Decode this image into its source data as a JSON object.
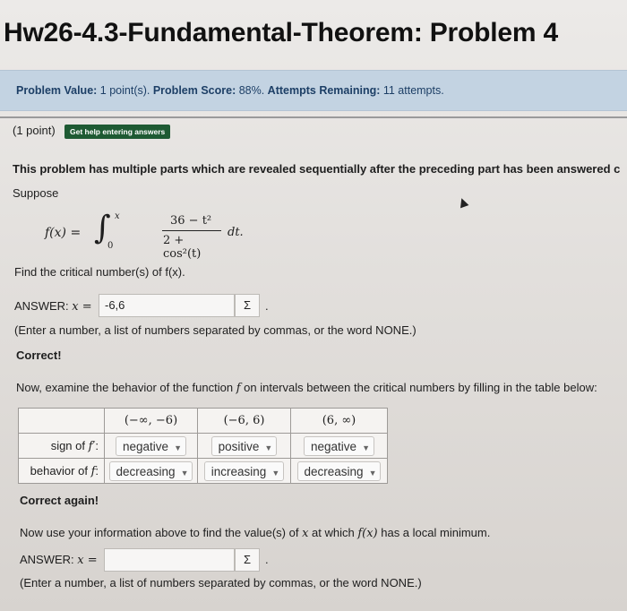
{
  "header": {
    "title": "Hw26-4.3-Fundamental-Theorem: Problem 4"
  },
  "info": {
    "value_label": "Problem Value:",
    "value_text": " 1 point(s). ",
    "score_label": "Problem Score:",
    "score_text": " 88%. ",
    "attempts_label": "Attempts Remaining:",
    "attempts_text": " 11 attempts."
  },
  "problem": {
    "points": "(1 point)",
    "help_button": "Get help entering answers",
    "intro": "This problem has multiple parts which are revealed sequentially after the preceding part has been answered c",
    "suppose": "Suppose",
    "formula": {
      "lhs": "f(x) =",
      "upper": "x",
      "lower": "0",
      "numerator": "36 − t²",
      "denominator": "2 + cos²(t)",
      "dt": "dt."
    },
    "part1": {
      "question": "Find the critical number(s) of f(x).",
      "answer_label": "ANSWER:",
      "answer_var": "x =",
      "answer_value": "-6,6",
      "sigma": "Σ",
      "period": ".",
      "hint": "(Enter a number, a list of numbers separated by commas, or the word NONE.)",
      "status": "Correct!"
    },
    "part2": {
      "prompt_a": "Now, examine the behavior of the function ",
      "prompt_f": "f",
      "prompt_b": " on intervals between the critical numbers by filling in the table below:",
      "headers": [
        "(−∞, −6)",
        "(−6, 6)",
        "(6, ∞)"
      ],
      "sign_label_a": "sign of ",
      "sign_label_f": "f′",
      "sign_label_b": ":",
      "sign_values": [
        "negative",
        "positive",
        "negative"
      ],
      "behavior_label_a": "behavior of ",
      "behavior_label_f": "f",
      "behavior_label_b": ":",
      "behavior_values": [
        "decreasing",
        "increasing",
        "decreasing"
      ],
      "status": "Correct again!"
    },
    "part3": {
      "prompt_a": "Now use your information above to find the value(s) of ",
      "prompt_x": "x",
      "prompt_b": " at which ",
      "prompt_fx": "f(x)",
      "prompt_c": " has a local minimum.",
      "answer_label": "ANSWER:",
      "answer_var": "x =",
      "answer_value": "",
      "sigma": "Σ",
      "period": ".",
      "hint": "(Enter a number, a list of numbers separated by commas, or the word NONE.)"
    }
  }
}
